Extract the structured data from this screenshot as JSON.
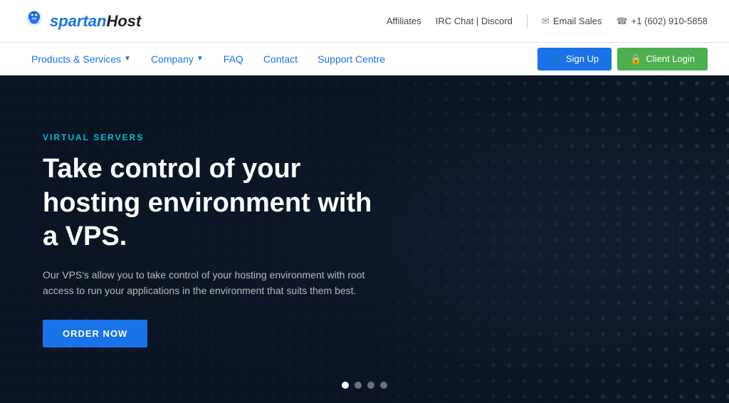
{
  "topbar": {
    "affiliates_label": "Affiliates",
    "irc_label": "IRC Chat | Discord",
    "email_label": "Email Sales",
    "phone_label": "+1 (602) 910-5858"
  },
  "logo": {
    "text_spartan": "spartan",
    "text_host": "Host"
  },
  "nav": {
    "products_label": "Products & Services",
    "company_label": "Company",
    "faq_label": "FAQ",
    "contact_label": "Contact",
    "support_label": "Support Centre",
    "signup_label": "Sign Up",
    "login_label": "Client Login"
  },
  "hero": {
    "category": "VIRTUAL SERVERS",
    "title": "Take control of your hosting environment with a VPS.",
    "description": "Our VPS's allow you to take control of your hosting environment with root access to run your applications in the environment that suits them best.",
    "order_button": "ORDER NOW"
  },
  "carousel": {
    "total_dots": 4,
    "active_dot": 0
  }
}
